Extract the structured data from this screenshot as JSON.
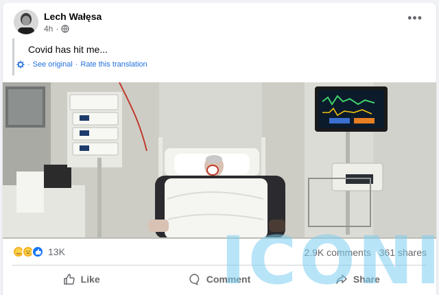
{
  "post": {
    "author": "Lech Wałęsa",
    "time": "4h",
    "separator": "·",
    "privacy_icon": "globe-icon",
    "more_icon": "•••",
    "text": "Covid has hit me...",
    "see_original": "See original",
    "translation_dot": "·",
    "rate_translation": "Rate this translation"
  },
  "stats": {
    "reaction_icons": [
      "care-reaction-icon",
      "sad-reaction-icon",
      "like-reaction-icon"
    ],
    "reaction_count": "13K",
    "comments": "2.9K comments",
    "shares": "361 shares"
  },
  "actions": {
    "like": "Like",
    "comment": "Comment",
    "share": "Share"
  },
  "watermark": {
    "text": "ICONIC"
  },
  "colors": {
    "link": "#216fdb",
    "muted": "#65676b",
    "like_blue": "#1877f2",
    "reaction_yellow": "#f7b125"
  }
}
